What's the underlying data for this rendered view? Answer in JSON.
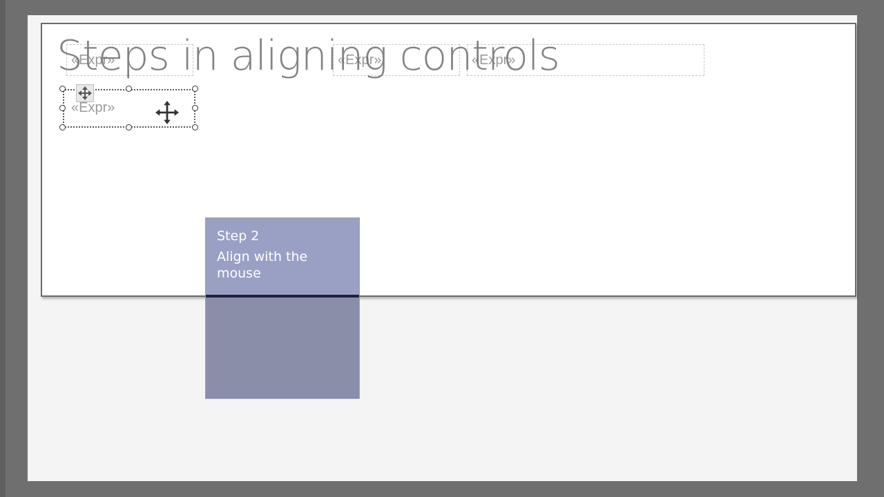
{
  "slide": {
    "title": "Steps in aligning controls"
  },
  "report": {
    "expr_boxes": [
      {
        "label": "«Expr»"
      },
      {
        "label": "«Expr»"
      },
      {
        "label": "«Expr»"
      }
    ],
    "selected_control": {
      "label": "«Expr»"
    }
  },
  "callout": {
    "step": "Step 2",
    "description": "Align with the mouse"
  },
  "colors": {
    "callout_top": "#9aa0c4",
    "callout_divider": "#1e2040",
    "callout_bottom": "#8a8ea8",
    "background": "#6f6f6f",
    "stage": "#f4f4f4"
  },
  "icons": {
    "selection_move_handle": "four-arrow-move-icon",
    "mouse_cursor": "move-cursor-icon"
  }
}
